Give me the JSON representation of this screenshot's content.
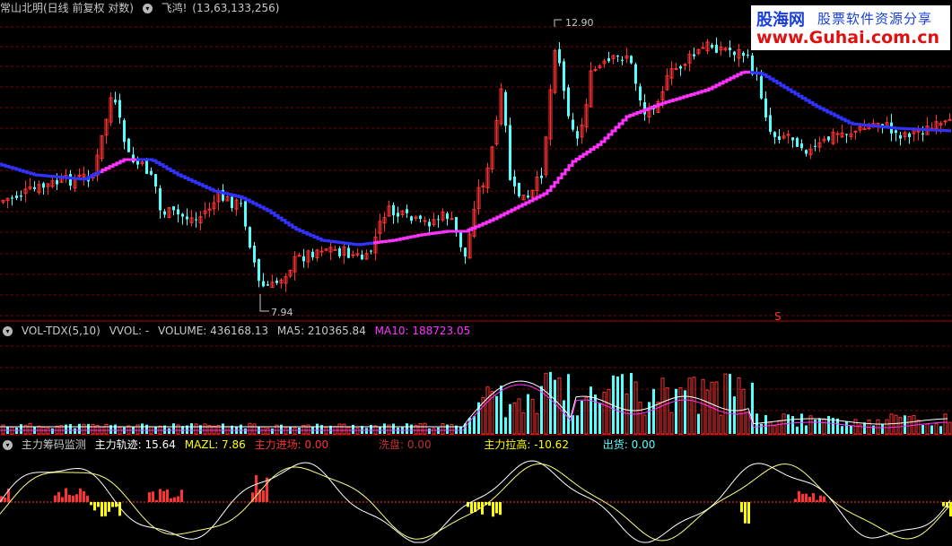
{
  "main_panel": {
    "title": "常山北明(日线 前复权 对数)",
    "indicator_name": "飞鸿!",
    "indicator_params": "(13,63,133,256)",
    "high_label": "12.90",
    "low_label": "7.94",
    "marker": "S"
  },
  "volume_panel": {
    "name": "VOL-TDX(5,10)",
    "vvol": "VVOL: -",
    "volume": "VOLUME: 436168.13",
    "ma5": "MA5: 210365.84",
    "ma10": "MA10: 188723.05"
  },
  "chip_panel": {
    "name": "主力筹码监测",
    "track": "主力轨迹: 15.64",
    "mazl": "MAZL: 7.86",
    "enter": "主力进场: 0.00",
    "wash": "洗盘: 0.00",
    "raise": "主力拉高: -10.62",
    "ship": "出货: 0.00"
  },
  "watermark": {
    "brand": "股海网",
    "slogan": "股票软件资源分享",
    "url": "www.Guhai.com.cn"
  },
  "colors": {
    "up": "#ff3232",
    "down": "#54ffff",
    "ma_down": "#3232ff",
    "ma_up": "#ff32ff",
    "grid": "#800000",
    "text_gray": "#c8c8c8",
    "yellow": "#ffff00",
    "white": "#ffffff"
  }
}
